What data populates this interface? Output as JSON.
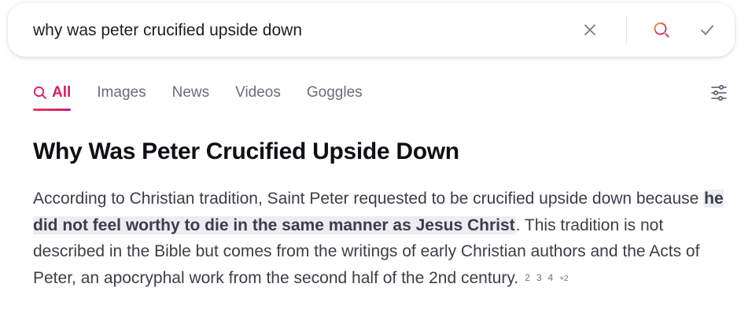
{
  "search": {
    "query": "why was peter crucified upside down",
    "icons": {
      "clear": "close-icon",
      "search": "search-icon",
      "confirm": "check-icon"
    },
    "accent": "#d81e5b"
  },
  "tabs": [
    {
      "label": "All",
      "active": true
    },
    {
      "label": "Images",
      "active": false
    },
    {
      "label": "News",
      "active": false
    },
    {
      "label": "Videos",
      "active": false
    },
    {
      "label": "Goggles",
      "active": false
    }
  ],
  "answer": {
    "title": "Why Was Peter Crucified Upside Down",
    "text_before": "According to Christian tradition, Saint Peter requested to be crucified upside down because ",
    "highlight": "he did not feel worthy to die in the same manner as Jesus Christ",
    "text_after": ". This tradition is not described in the Bible but comes from the writings of early Christian authors and the Acts of Peter, an apocryphal work from the second half of the 2nd century.",
    "citations": [
      "2",
      "3",
      "4",
      "+2"
    ]
  }
}
